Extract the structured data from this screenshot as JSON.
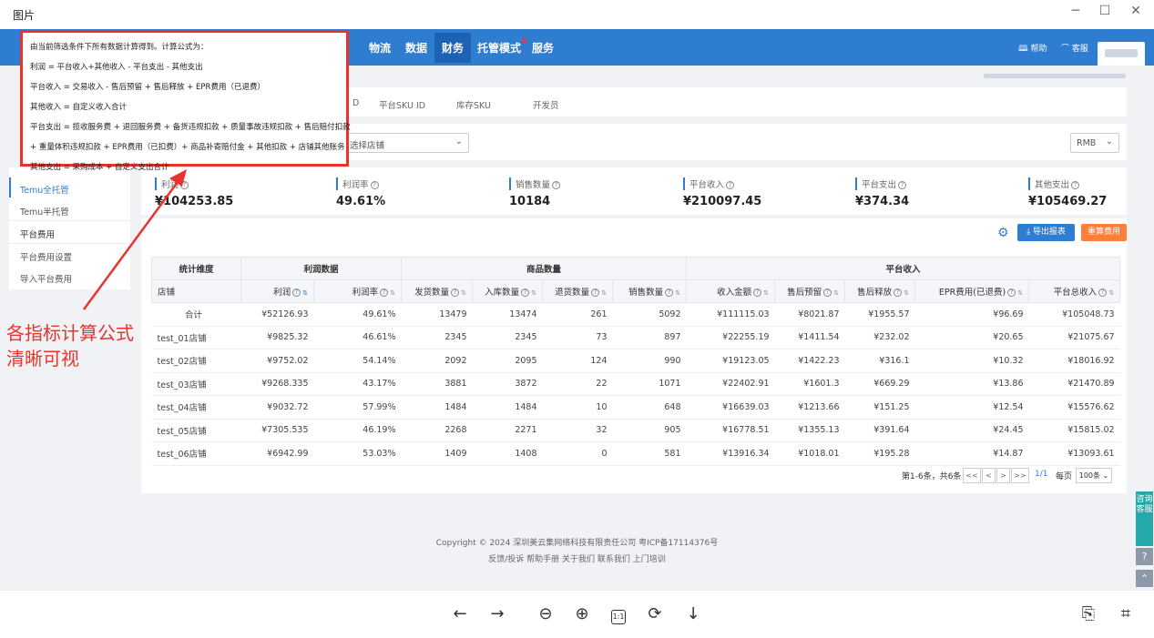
{
  "viewer": {
    "title": "图片"
  },
  "nav": {
    "items": [
      {
        "label": "物流"
      },
      {
        "label": "数据"
      },
      {
        "label": "财务"
      },
      {
        "label": "托管模式"
      },
      {
        "label": "服务"
      }
    ],
    "help": "帮助",
    "support": "客服"
  },
  "tooltip": {
    "lines": [
      "由当前筛选条件下所有数据计算得到。计算公式为：",
      "利润 = 平台收入+其他收入 - 平台支出 - 其他支出",
      "平台收入 = 交易收入 - 售后预留 + 售后释放 + EPR费用（已退费）",
      "其他收入 = 自定义收入合计",
      "平台支出 = 揽收服务费 + 退回服务费 + 备货违规扣款 + 质量事故违规扣款 + 售后赔付扣款",
      "+ 重量体积违规扣款 + EPR费用（已扣费）+ 商品补寄赔付金 + 其他扣款 + 店铺其他账务",
      "其他支出 = 采购成本 + 自定义支出合计"
    ]
  },
  "annotation": {
    "line1": "各指标计算公式",
    "line2": "清晰可视"
  },
  "filters": {
    "tabs": [
      "D",
      "平台SKU ID",
      "库存SKU",
      "开发员"
    ],
    "store_placeholder": "选择店铺",
    "currency": "RMB"
  },
  "menu": {
    "items": [
      {
        "label": "Temu全托管"
      },
      {
        "label": "Temu半托管"
      }
    ],
    "section": "平台费用",
    "sub_items": [
      {
        "label": "平台费用设置"
      },
      {
        "label": "导入平台费用"
      }
    ]
  },
  "kpis": [
    {
      "label": "利润",
      "value": "¥104253.85"
    },
    {
      "label": "利润率",
      "value": "49.61%"
    },
    {
      "label": "销售数量",
      "value": "10184"
    },
    {
      "label": "平台收入",
      "value": "¥210097.45"
    },
    {
      "label": "平台支出",
      "value": "¥374.34"
    },
    {
      "label": "其他支出",
      "value": "¥105469.27"
    }
  ],
  "actions": {
    "export": "导出报表",
    "recalc": "重算费用"
  },
  "table": {
    "groups": [
      "统计维度",
      "利润数据",
      "商品数量",
      "平台收入"
    ],
    "columns": [
      "店铺",
      "利润",
      "利润率",
      "发货数量",
      "入库数量",
      "退货数量",
      "销售数量",
      "收入金额",
      "售后预留",
      "售后释放",
      "EPR费用(已退费)",
      "平台总收入"
    ],
    "rows": [
      [
        "合计",
        "¥52126.93",
        "49.61%",
        "13479",
        "13474",
        "261",
        "5092",
        "¥111115.03",
        "¥8021.87",
        "¥1955.57",
        "¥96.69",
        "¥105048.73"
      ],
      [
        "test_01店铺",
        "¥9825.32",
        "46.61%",
        "2345",
        "2345",
        "73",
        "897",
        "¥22255.19",
        "¥1411.54",
        "¥232.02",
        "¥20.65",
        "¥21075.67"
      ],
      [
        "test_02店铺",
        "¥9752.02",
        "54.14%",
        "2092",
        "2095",
        "124",
        "990",
        "¥19123.05",
        "¥1422.23",
        "¥316.1",
        "¥10.32",
        "¥18016.92"
      ],
      [
        "test_03店铺",
        "¥9268.335",
        "43.17%",
        "3881",
        "3872",
        "22",
        "1071",
        "¥22402.91",
        "¥1601.3",
        "¥669.29",
        "¥13.86",
        "¥21470.89"
      ],
      [
        "test_04店铺",
        "¥9032.72",
        "57.99%",
        "1484",
        "1484",
        "10",
        "648",
        "¥16639.03",
        "¥1213.66",
        "¥151.25",
        "¥12.54",
        "¥15576.62"
      ],
      [
        "test_05店铺",
        "¥7305.535",
        "46.19%",
        "2268",
        "2271",
        "32",
        "905",
        "¥16778.51",
        "¥1355.13",
        "¥391.64",
        "¥24.45",
        "¥15815.02"
      ],
      [
        "test_06店铺",
        "¥6942.99",
        "53.03%",
        "1409",
        "1408",
        "0",
        "581",
        "¥13916.34",
        "¥1018.01",
        "¥195.28",
        "¥14.87",
        "¥13093.61"
      ]
    ]
  },
  "pagination": {
    "summary": "第1-6条，共6条",
    "first": "<<",
    "prev": "<",
    "next": ">",
    "last": ">>",
    "page": "1/1",
    "per_page_label": "每页",
    "per_page": "100条"
  },
  "footer": {
    "copyright": "Copyright © 2024 深圳美云集网络科技有限责任公司 粤ICP备17114376号",
    "links": [
      "反馈/投诉",
      "帮助手册",
      "关于我们",
      "联系我们",
      "上门培训"
    ]
  },
  "side": {
    "consult": "咨询客服"
  },
  "colors": {
    "brand": "#2f7dd1",
    "accent": "#ff7e3c",
    "highlight": "#e8342d"
  }
}
